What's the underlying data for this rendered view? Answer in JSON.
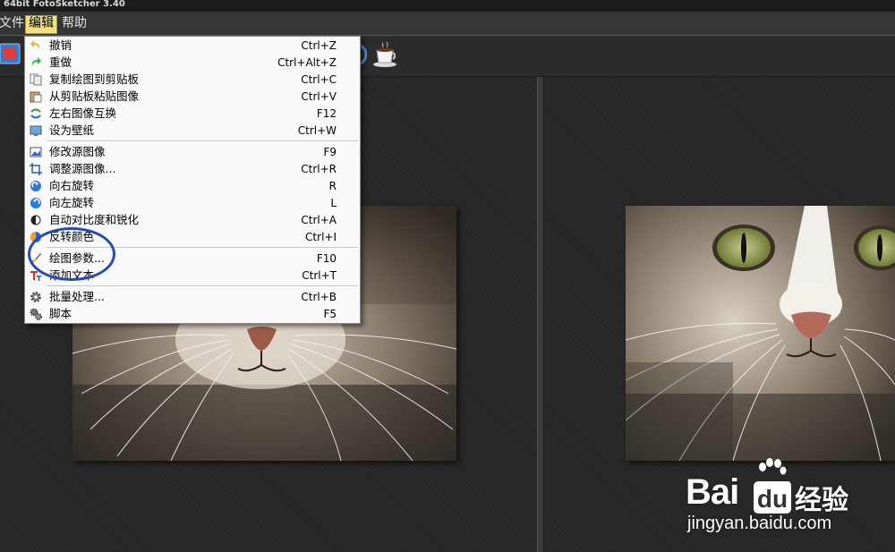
{
  "window": {
    "title": "64bit FotoSketcher 3.40"
  },
  "menubar": {
    "items": [
      {
        "label": "文件"
      },
      {
        "label": "编辑"
      },
      {
        "label": "帮助"
      }
    ]
  },
  "edit_menu": {
    "items": [
      {
        "label": "撤销",
        "shortcut": "Ctrl+Z",
        "icon": "undo-icon"
      },
      {
        "label": "重做",
        "shortcut": "Ctrl+Alt+Z",
        "icon": "redo-icon"
      },
      {
        "label": "复制绘图到剪贴板",
        "shortcut": "Ctrl+C",
        "icon": "copy-icon"
      },
      {
        "label": "从剪贴板粘贴图像",
        "shortcut": "Ctrl+V",
        "icon": "paste-icon"
      },
      {
        "label": "左右图像互换",
        "shortcut": "F12",
        "icon": "swap-icon"
      },
      {
        "label": "设为壁纸",
        "shortcut": "Ctrl+W",
        "icon": "wallpaper-icon"
      },
      {
        "label": "修改源图像",
        "shortcut": "F9",
        "icon": "edit-image-icon"
      },
      {
        "label": "调整源图像...",
        "shortcut": "Ctrl+R",
        "icon": "crop-icon"
      },
      {
        "label": "向右旋转",
        "shortcut": "R",
        "icon": "rotate-right-icon"
      },
      {
        "label": "向左旋转",
        "shortcut": "L",
        "icon": "rotate-left-icon"
      },
      {
        "label": "自动对比度和锐化",
        "shortcut": "Ctrl+A",
        "icon": "contrast-icon"
      },
      {
        "label": "反转颜色",
        "shortcut": "Ctrl+I",
        "icon": "invert-icon"
      },
      {
        "label": "绘图参数...",
        "shortcut": "F10",
        "icon": "brush-icon"
      },
      {
        "label": "添加文本",
        "shortcut": "Ctrl+T",
        "icon": "text-icon"
      },
      {
        "label": "批量处理...",
        "shortcut": "Ctrl+B",
        "icon": "batch-gear-icon"
      },
      {
        "label": "脚本",
        "shortcut": "F5",
        "icon": "script-gears-icon"
      }
    ]
  },
  "watermark": {
    "brand_left": "Bai",
    "brand_right": "经验",
    "url": "jingyan.baidu.com"
  },
  "colors": {
    "menu_highlight": "#f0e083",
    "annotation_circle": "#2449b8"
  }
}
